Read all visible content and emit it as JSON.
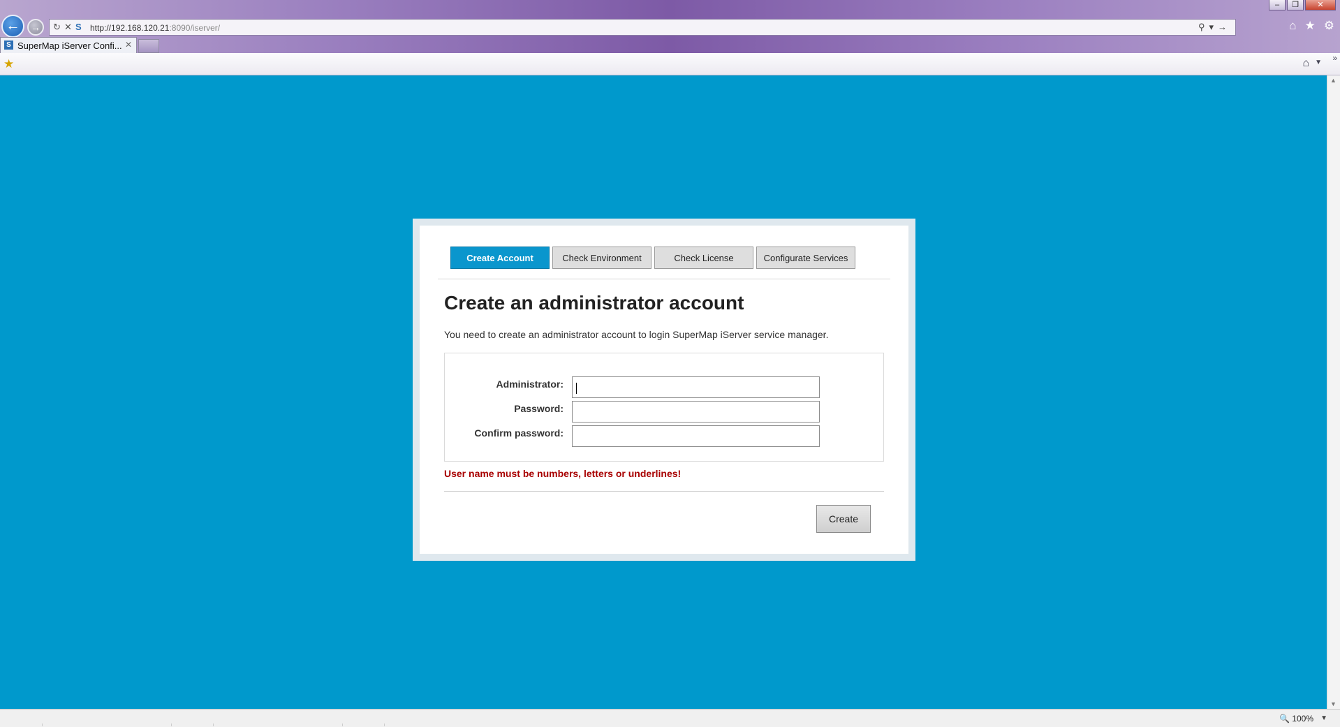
{
  "browser": {
    "url_host": "http://192.168.120.21",
    "url_rest": ":8090/iserver/",
    "tab_title": "SuperMap iServer Confi...",
    "zoom": "100%"
  },
  "wizard": {
    "steps": [
      "Create Account",
      "Check Environment",
      "Check License",
      "Configurate Services"
    ],
    "active_step": "Create Account",
    "heading": "Create an administrator account",
    "description": "You need to create an administrator account to login SuperMap iServer service manager.",
    "fields": {
      "administrator_label": "Administrator:",
      "administrator_value": "",
      "password_label": "Password:",
      "password_value": "",
      "confirm_label": "Confirm password:",
      "confirm_value": ""
    },
    "error": "User name must be numbers, letters or underlines!",
    "create_label": "Create"
  },
  "colors": {
    "page_background": "#0099cc",
    "active_tab": "#0a96cd",
    "error_text": "#a80000"
  }
}
